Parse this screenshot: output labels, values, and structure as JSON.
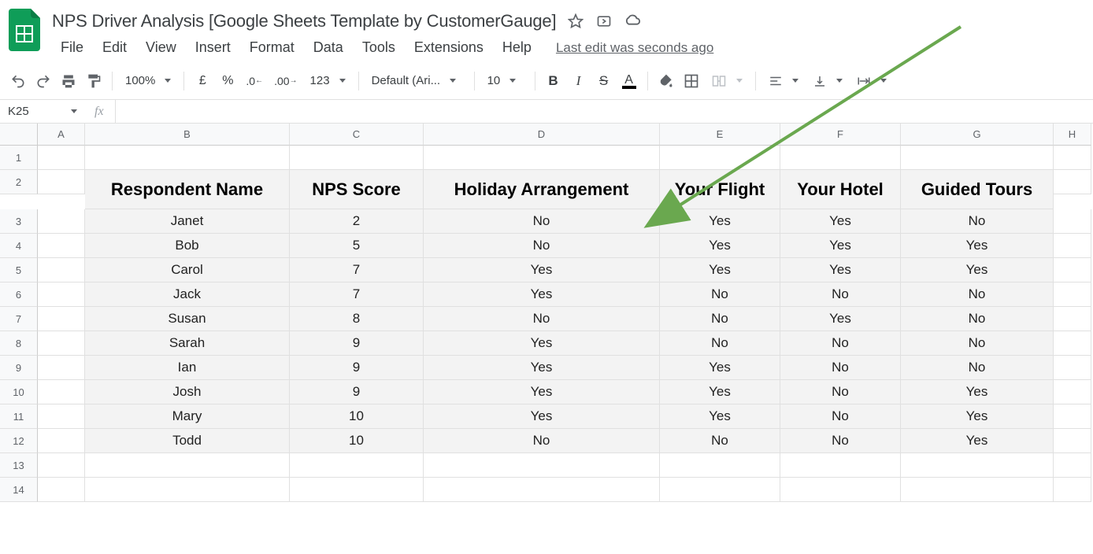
{
  "doc": {
    "title": "NPS Driver Analysis [Google Sheets Template by CustomerGauge]"
  },
  "menubar": [
    "File",
    "Edit",
    "View",
    "Insert",
    "Format",
    "Data",
    "Tools",
    "Extensions",
    "Help"
  ],
  "last_edit": "Last edit was seconds ago",
  "toolbar": {
    "zoom": "100%",
    "currency": "£",
    "percent": "%",
    "dec_dec": ".0",
    "inc_dec": ".00",
    "format123": "123",
    "font": "Default (Ari...",
    "fontsize": "10"
  },
  "namebox": "K25",
  "columns": [
    "A",
    "B",
    "C",
    "D",
    "E",
    "F",
    "G",
    "H"
  ],
  "headers": [
    "Respondent Name",
    "NPS Score",
    "Holiday Arrangement",
    "Your Flight",
    "Your Hotel",
    "Guided Tours"
  ],
  "rows": [
    {
      "name": "Janet",
      "score": "2",
      "ha": "No",
      "flight": "Yes",
      "hotel": "Yes",
      "tours": "No"
    },
    {
      "name": "Bob",
      "score": "5",
      "ha": "No",
      "flight": "Yes",
      "hotel": "Yes",
      "tours": "Yes"
    },
    {
      "name": "Carol",
      "score": "7",
      "ha": "Yes",
      "flight": "Yes",
      "hotel": "Yes",
      "tours": "Yes"
    },
    {
      "name": "Jack",
      "score": "7",
      "ha": "Yes",
      "flight": "No",
      "hotel": "No",
      "tours": "No"
    },
    {
      "name": "Susan",
      "score": "8",
      "ha": "No",
      "flight": "No",
      "hotel": "Yes",
      "tours": "No"
    },
    {
      "name": "Sarah",
      "score": "9",
      "ha": "Yes",
      "flight": "No",
      "hotel": "No",
      "tours": "No"
    },
    {
      "name": "Ian",
      "score": "9",
      "ha": "Yes",
      "flight": "Yes",
      "hotel": "No",
      "tours": "No"
    },
    {
      "name": "Josh",
      "score": "9",
      "ha": "Yes",
      "flight": "Yes",
      "hotel": "No",
      "tours": "Yes"
    },
    {
      "name": "Mary",
      "score": "10",
      "ha": "Yes",
      "flight": "Yes",
      "hotel": "No",
      "tours": "Yes"
    },
    {
      "name": "Todd",
      "score": "10",
      "ha": "No",
      "flight": "No",
      "hotel": "No",
      "tours": "Yes"
    }
  ],
  "row_numbers": [
    "1",
    "2",
    "3",
    "4",
    "5",
    "6",
    "7",
    "8",
    "9",
    "10",
    "11",
    "12",
    "13",
    "14"
  ]
}
